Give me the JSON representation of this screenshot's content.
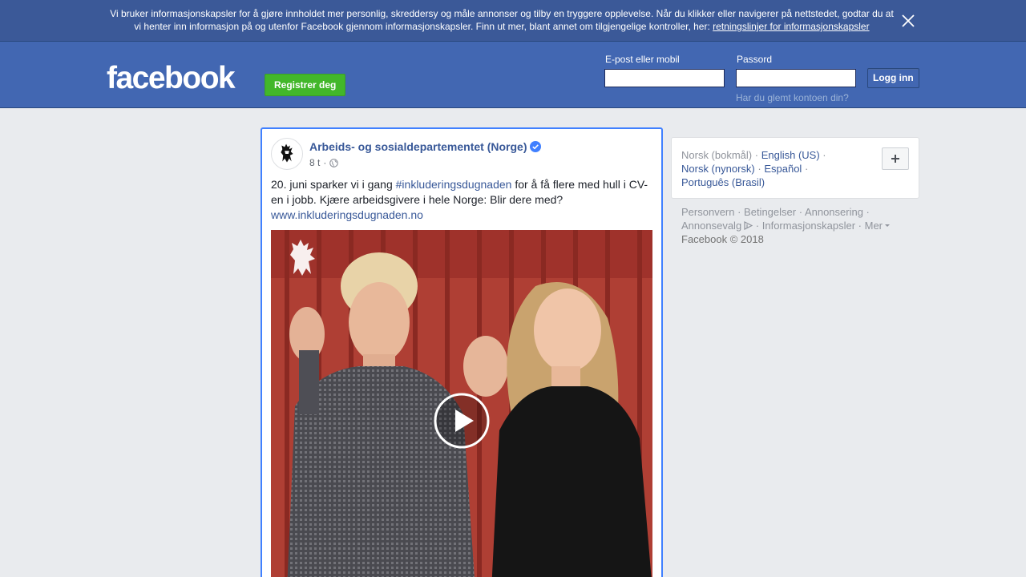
{
  "cookie_banner": {
    "text_line1": "Vi bruker informasjonskapsler for å gjøre innholdet mer personlig, skreddersy og måle annonser og tilby en tryggere opplevelse. Når du klikker eller navigerer på nettstedet, godtar du at",
    "text_line2": "vi henter inn informasjon på og utenfor Facebook gjennom informasjonskapsler. Finn ut mer, blant annet om tilgjengelige kontroller, her:",
    "link_text": "retningslinjer for informasjonskapsler",
    "close_icon": "close-icon"
  },
  "header": {
    "logo_text": "facebook",
    "register_label": "Registrer deg",
    "email_label": "E-post eller mobil",
    "email_value": "",
    "password_label": "Passord",
    "password_value": "",
    "login_label": "Logg inn",
    "forgot_text": "Har du glemt kontoen din?",
    "brand_color": "#4267b2",
    "register_color": "#42b72a"
  },
  "post": {
    "page_name": "Arbeids- og sosialdepartementet (Norge)",
    "verified_icon": "verified-badge-icon",
    "time": "8 t",
    "separator": "·",
    "privacy_icon": "globe-icon",
    "text_before": "20. juni sparker vi i gang ",
    "hashtag": "#inkluderingsdugnaden",
    "text_after": " for å få flere med hull i CV-en i jobb. Kjære arbeidsgivere i hele Norge: Blir dere med?",
    "link": "www.inkluderingsdugnaden.no",
    "video_icon": "play-icon"
  },
  "languages": {
    "current": "Norsk (bokmål)",
    "options": [
      "English (US)",
      "Norsk (nynorsk)",
      "Español",
      "Português (Brasil)"
    ],
    "add_icon": "plus-icon"
  },
  "footer": {
    "links": [
      "Personvern",
      "Betingelser",
      "Annonsering",
      "Annonsevalg",
      "Informasjonskapsler",
      "Mer"
    ],
    "copyright": "Facebook © 2018"
  }
}
